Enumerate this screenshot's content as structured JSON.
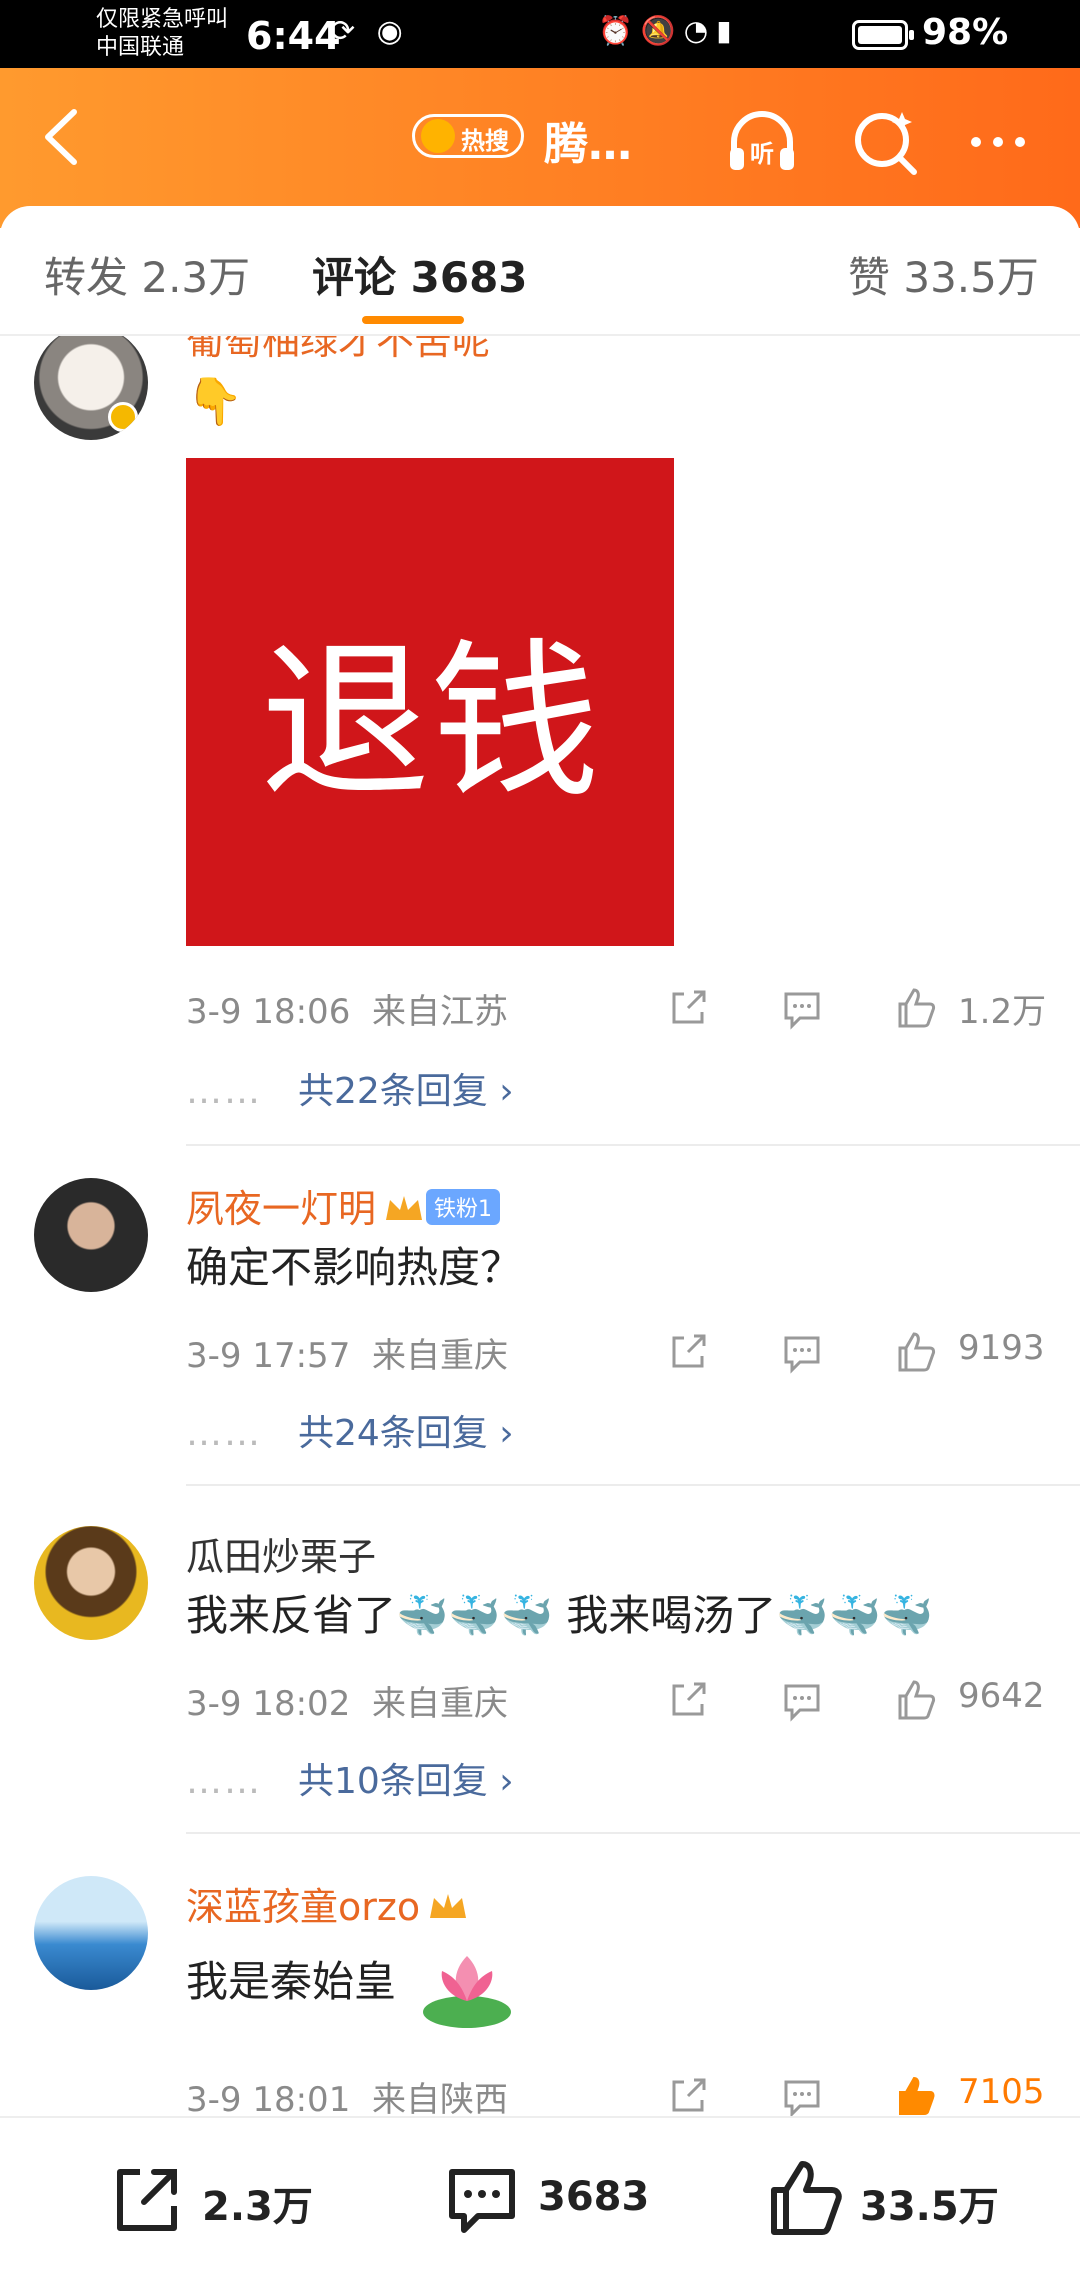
{
  "status_bar": {
    "carrier_line1": "仅限紧急呼叫",
    "carrier_line2": "中国联通",
    "time": "6:44",
    "battery": "98%",
    "icons": [
      "alarm-icon",
      "mute-icon",
      "wifi-icon",
      "signal-icon"
    ]
  },
  "header": {
    "hot_label": "热搜",
    "title": "腾…",
    "listen_label": "听"
  },
  "tabs": [
    {
      "label": "转发 2.3万"
    },
    {
      "label": "评论 3683"
    },
    {
      "label": "赞 33.5万"
    }
  ],
  "comments": [
    {
      "user": "葡萄柚绿才不苦呢",
      "text": "👇",
      "image_text": "退钱",
      "time": "3-9 18:06",
      "location": "来自江苏",
      "likes": "1.2万",
      "replies": "共22条回复"
    },
    {
      "user": "夙夜一灯明",
      "badge": "铁粉1",
      "text": "确定不影响热度？",
      "time": "3-9 17:57",
      "location": "来自重庆",
      "likes": "9193",
      "replies": "共24条回复"
    },
    {
      "user": "瓜田炒栗子",
      "text": "我来反省了🐳🐳🐳 我来喝汤了🐳🐳🐳",
      "time": "3-9 18:02",
      "location": "来自重庆",
      "likes": "9642",
      "replies": "共10条回复"
    },
    {
      "user": "深蓝孩童orzo",
      "text": "我是秦始皇",
      "time": "3-9 18:01",
      "location": "来自陕西",
      "likes": "7105"
    }
  ],
  "bottom_bar": {
    "repost": "2.3万",
    "comment": "3683",
    "like": "33.5万"
  },
  "colors": {
    "header_start": "#ff9a2e",
    "header_end": "#ff6a1a",
    "username": "#e86722",
    "reply_link": "#4a6a9c",
    "image_red": "#d0161a"
  }
}
